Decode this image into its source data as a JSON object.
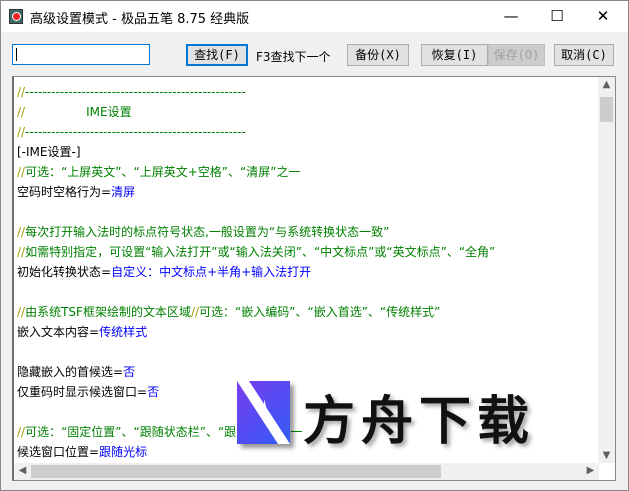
{
  "window": {
    "title": "高级设置模式 - 极品五笔 8.75 经典版",
    "minimize": "—",
    "maximize": "☐",
    "close": "✕"
  },
  "toolbar": {
    "search_value": "",
    "find": "查找(F)",
    "hint": "F3查找下一个",
    "backup": "备份(X)",
    "restore": "恢复(I)",
    "save": "保存(O)",
    "cancel": "取消(C)"
  },
  "lines": [
    {
      "parts": [
        [
          "s",
          "//"
        ],
        [
          "c",
          "---------------------------------------------------"
        ]
      ]
    },
    {
      "parts": [
        [
          "s",
          "//"
        ],
        [
          "c",
          "                IME设置"
        ]
      ]
    },
    {
      "parts": [
        [
          "s",
          "//"
        ],
        [
          "c",
          "---------------------------------------------------"
        ]
      ]
    },
    {
      "parts": [
        [
          "k",
          "[-IME设置-]"
        ]
      ]
    },
    {
      "parts": [
        [
          "s",
          "//"
        ],
        [
          "c",
          "可选：“上屏英文”、“上屏英文+空格”、“清屏”之一"
        ]
      ]
    },
    {
      "parts": [
        [
          "k",
          "空码时空格行为="
        ],
        [
          "v",
          "清屏"
        ]
      ]
    },
    {
      "parts": []
    },
    {
      "parts": [
        [
          "s",
          "//"
        ],
        [
          "c",
          "每次打开输入法时的标点符号状态,一般设置为“与系统转换状态一致”"
        ]
      ]
    },
    {
      "parts": [
        [
          "s",
          "//"
        ],
        [
          "c",
          "如需特别指定，可设置“输入法打开”或“输入法关闭”、“中文标点”或“英文标点”、“全角”"
        ]
      ]
    },
    {
      "parts": [
        [
          "k",
          "初始化转换状态="
        ],
        [
          "v",
          "自定义：中文标点+半角+输入法打开"
        ]
      ]
    },
    {
      "parts": []
    },
    {
      "parts": [
        [
          "s",
          "//"
        ],
        [
          "c",
          "由系统TSF框架绘制的文本区域"
        ],
        [
          "s",
          "//"
        ],
        [
          "c",
          "可选：“嵌入编码”、“嵌入首选”、“传统样式”"
        ]
      ]
    },
    {
      "parts": [
        [
          "k",
          "嵌入文本内容="
        ],
        [
          "v",
          "传统样式"
        ]
      ]
    },
    {
      "parts": []
    },
    {
      "parts": [
        [
          "k",
          "隐藏嵌入的首候选="
        ],
        [
          "v",
          "否"
        ]
      ]
    },
    {
      "parts": [
        [
          "k",
          "仅重码时显示候选窗口="
        ],
        [
          "v",
          "否"
        ]
      ]
    },
    {
      "parts": []
    },
    {
      "parts": [
        [
          "s",
          "//"
        ],
        [
          "c",
          "可选：“固定位置”、“跟随状态栏”、“跟随光标”之一"
        ]
      ]
    },
    {
      "parts": [
        [
          "k",
          "候选窗口位置="
        ],
        [
          "v",
          "跟随光标"
        ]
      ]
    }
  ],
  "watermark": {
    "text": "方舟下载"
  }
}
